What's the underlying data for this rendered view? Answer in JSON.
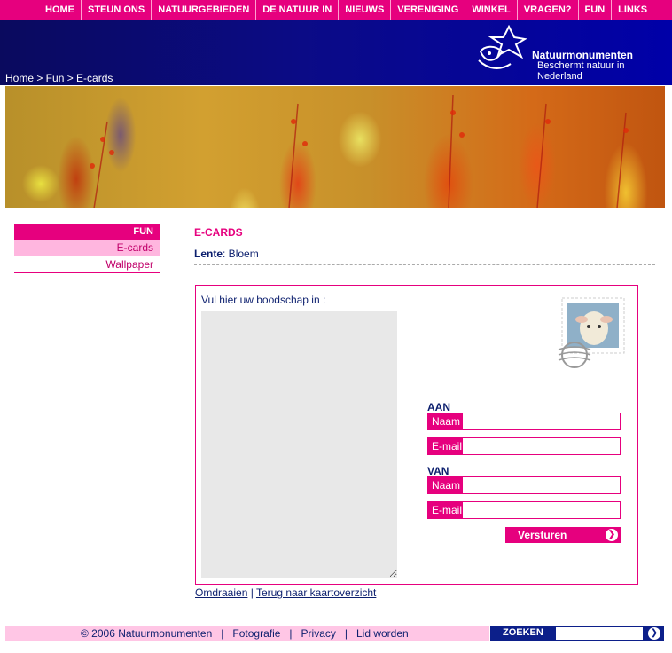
{
  "nav": [
    "HOME",
    "STEUN ONS",
    "NATUURGEBIEDEN",
    "DE NATUUR IN",
    "NIEUWS",
    "VERENIGING",
    "WINKEL",
    "VRAGEN?",
    "FUN",
    "LINKS"
  ],
  "breadcrumb": "Home > Fun > E-cards",
  "logo": {
    "name": "Natuurmonumenten",
    "tagline": "Beschermt natuur in Nederland"
  },
  "sidebar": {
    "heading": "FUN",
    "items": [
      {
        "label": "E-cards",
        "active": true
      },
      {
        "label": "Wallpaper",
        "active": false
      }
    ]
  },
  "content": {
    "title": "E-CARDS",
    "subtitle_bold": "Lente",
    "subtitle_rest": ": Bloem",
    "message_label": "Vul hier uw boodschap in :",
    "to_heading": "AAN",
    "from_heading": "VAN",
    "name_label": "Naam",
    "email_label": "E-mail adres",
    "send_label": "Versturen",
    "flip_link": "Omdraaien",
    "separator": "|",
    "back_link": "Terug naar kaartoverzicht"
  },
  "footer": {
    "text": "© 2006 Natuurmonumenten   |   Fotografie   |   Privacy   |   Lid worden",
    "search_label": "ZOEKEN"
  },
  "colors": {
    "accent": "#e6007e",
    "navy": "#0c1f6e"
  }
}
